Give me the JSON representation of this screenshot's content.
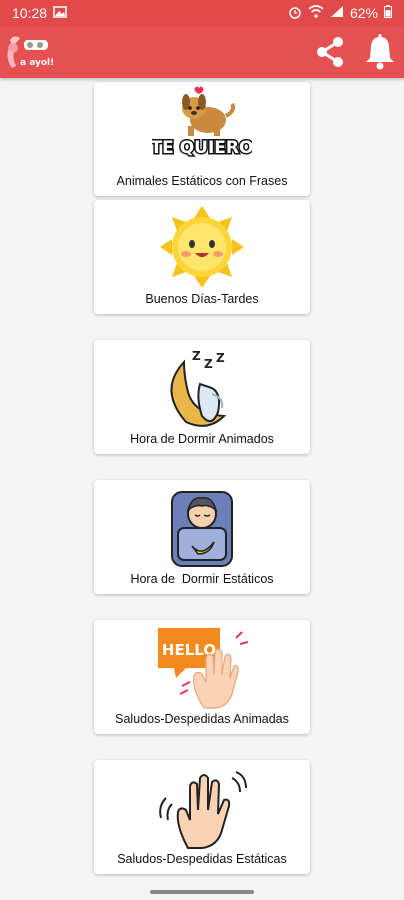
{
  "status_bar": {
    "time": "10:28",
    "battery": "62%"
  },
  "app_bar": {
    "logo_text": "a ayol!",
    "share_icon": "share-icon",
    "bell_icon": "bell-icon"
  },
  "categories": [
    {
      "label": "Animales Estáticos con Frases",
      "art_text": "TE QUIERO",
      "icon": "dog-te-quiero-icon"
    },
    {
      "label": "Buenos Días-Tardes",
      "icon": "smiling-sun-icon"
    },
    {
      "label": "Hora de Dormir Animados",
      "icon": "sleeping-moon-icon"
    },
    {
      "label": "Hora de  Dormir Estáticos",
      "icon": "sleeping-baby-icon"
    },
    {
      "label": "Saludos-Despedidas Animadas",
      "art_text": "HELLO",
      "icon": "hello-wave-icon"
    },
    {
      "label": "Saludos-Despedidas Estáticas",
      "icon": "waving-hand-icon"
    }
  ],
  "colors": {
    "appbar": "#e55050",
    "statusbar": "#e24a4a",
    "background": "#f4f4f4"
  }
}
